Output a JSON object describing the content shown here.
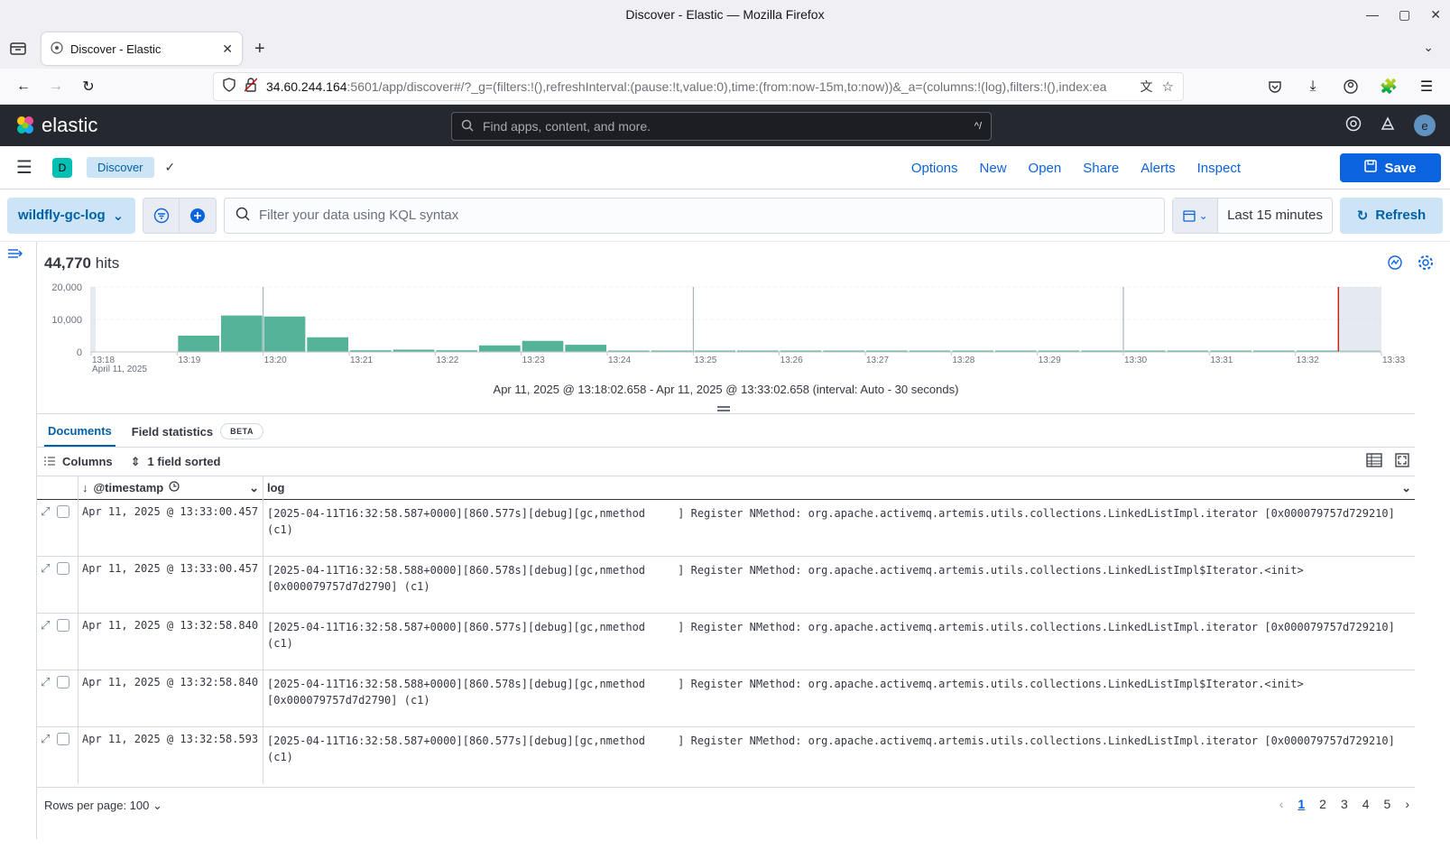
{
  "browser": {
    "window_title": "Discover - Elastic — Mozilla Firefox",
    "tab_title": "Discover - Elastic",
    "url_host": "34.60.244.164",
    "url_rest": ":5601/app/discover#/?_g=(filters:!(),refreshInterval:(pause:!t,value:0),time:(from:now-15m,to:now))&_a=(columns:!(log),filters:!(),index:ea"
  },
  "kibana": {
    "brand": "elastic",
    "search_placeholder": "Find apps, content, and more.",
    "search_shortcut": "^/",
    "avatar_letter": "e"
  },
  "topnav": {
    "space_letter": "D",
    "breadcrumb": "Discover",
    "links": [
      "Options",
      "New",
      "Open",
      "Share",
      "Alerts",
      "Inspect"
    ],
    "save_label": "Save"
  },
  "query": {
    "data_view": "wildfly-gc-log",
    "kql_placeholder": "Filter your data using KQL syntax",
    "time_label": "Last 15 minutes",
    "refresh_label": "Refresh"
  },
  "hits": {
    "count": "44,770",
    "label": "hits"
  },
  "chart_data": {
    "type": "bar",
    "y_ticks": [
      "20,000",
      "10,000",
      "0"
    ],
    "ylim": [
      0,
      20000
    ],
    "x_ticks": [
      "13:18",
      "13:19",
      "13:20",
      "13:21",
      "13:22",
      "13:23",
      "13:24",
      "13:25",
      "13:26",
      "13:27",
      "13:28",
      "13:29",
      "13:30",
      "13:31",
      "13:32",
      "13:33"
    ],
    "x_date_label": "April 11, 2025",
    "values": [
      0,
      0,
      5000,
      11200,
      10900,
      4500,
      500,
      700,
      500,
      2000,
      3400,
      2200,
      400,
      400,
      400,
      400,
      400,
      400,
      400,
      400,
      400,
      400,
      400,
      400,
      400,
      400,
      400,
      400,
      400,
      400
    ],
    "range_text": "Apr 11, 2025 @ 13:18:02.658 - Apr 11, 2025 @ 13:33:02.658 (interval: Auto - 30 seconds)",
    "bar_color": "#54b399"
  },
  "doc_tabs": {
    "documents": "Documents",
    "field_stats": "Field statistics",
    "beta": "BETA"
  },
  "grid_toolbar": {
    "columns": "Columns",
    "sorted": "1 field sorted"
  },
  "grid": {
    "col_timestamp": "@timestamp",
    "col_log": "log",
    "rows": [
      {
        "ts": "Apr 11, 2025 @ 13:33:00.457",
        "log": "[2025-04-11T16:32:58.587+0000][860.577s][debug][gc,nmethod     ] Register NMethod: org.apache.activemq.artemis.utils.collections.LinkedListImpl.iterator [0x000079757d729210] (c1)"
      },
      {
        "ts": "Apr 11, 2025 @ 13:33:00.457",
        "log": "[2025-04-11T16:32:58.588+0000][860.578s][debug][gc,nmethod     ] Register NMethod: org.apache.activemq.artemis.utils.collections.LinkedListImpl$Iterator.<init>\n[0x000079757d7d2790] (c1)"
      },
      {
        "ts": "Apr 11, 2025 @ 13:32:58.840",
        "log": "[2025-04-11T16:32:58.587+0000][860.577s][debug][gc,nmethod     ] Register NMethod: org.apache.activemq.artemis.utils.collections.LinkedListImpl.iterator [0x000079757d729210] (c1)"
      },
      {
        "ts": "Apr 11, 2025 @ 13:32:58.840",
        "log": "[2025-04-11T16:32:58.588+0000][860.578s][debug][gc,nmethod     ] Register NMethod: org.apache.activemq.artemis.utils.collections.LinkedListImpl$Iterator.<init>\n[0x000079757d7d2790] (c1)"
      },
      {
        "ts": "Apr 11, 2025 @ 13:32:58.593",
        "log": "[2025-04-11T16:32:58.587+0000][860.577s][debug][gc,nmethod     ] Register NMethod: org.apache.activemq.artemis.utils.collections.LinkedListImpl.iterator [0x000079757d729210] (c1)"
      }
    ]
  },
  "footer": {
    "rows_per_page": "Rows per page: 100",
    "pages": [
      "1",
      "2",
      "3",
      "4",
      "5"
    ]
  },
  "colors": {
    "accent": "#0b64dd",
    "header_bg": "#25282f",
    "bar": "#54b399"
  }
}
